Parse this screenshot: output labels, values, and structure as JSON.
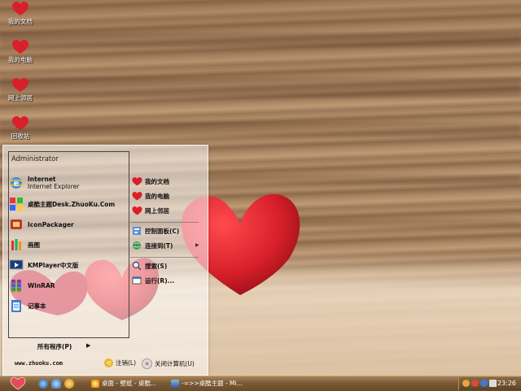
{
  "desktop": {
    "icons": [
      {
        "label": "我的文档",
        "icon": "heart-icon"
      },
      {
        "label": "我的电脑",
        "icon": "heart-icon"
      },
      {
        "label": "网上邻居",
        "icon": "heart-icon"
      },
      {
        "label": "回收站",
        "icon": "heart-icon"
      }
    ]
  },
  "start_menu": {
    "user": "Administrator",
    "pinned": [
      {
        "title": "Internet",
        "subtitle": "Internet Explorer",
        "icon": "internet-explorer-icon"
      },
      {
        "title": "桌酷主题Desk.ZhuoKu.Com",
        "icon": "zhuoku-theme-icon"
      }
    ],
    "recent": [
      {
        "title": "IconPackager",
        "icon": "iconpackager-icon"
      },
      {
        "title": "画图",
        "icon": "paint-icon"
      },
      {
        "title": "KMPlayer中文版",
        "icon": "kmplayer-icon"
      },
      {
        "title": "WinRAR",
        "icon": "winrar-icon"
      },
      {
        "title": "记事本",
        "icon": "notepad-icon"
      }
    ],
    "all_programs": "所有程序(P)",
    "right": {
      "places": [
        "我的文档",
        "我的电脑",
        "网上邻居"
      ],
      "control_panel": "控制面板(C)",
      "connect_to": "连接到(T)",
      "search": "搜索(S)",
      "run": "运行(R)..."
    },
    "footer": {
      "url": "www.zhuoku.com",
      "logoff": "注销(L)",
      "shutdown": "关闭计算机(U)"
    }
  },
  "taskbar": {
    "tasks": [
      {
        "label": "桌面 - 壁纸 - 桌酷...",
        "icon": "browser-icon"
      },
      {
        "label": "-=>>桌酷主题 - Mi...",
        "icon": "window-icon"
      }
    ],
    "clock": "23:26"
  },
  "colors": {
    "heart_red": "#d8202a",
    "taskbar_brown": "#7b5a35"
  }
}
